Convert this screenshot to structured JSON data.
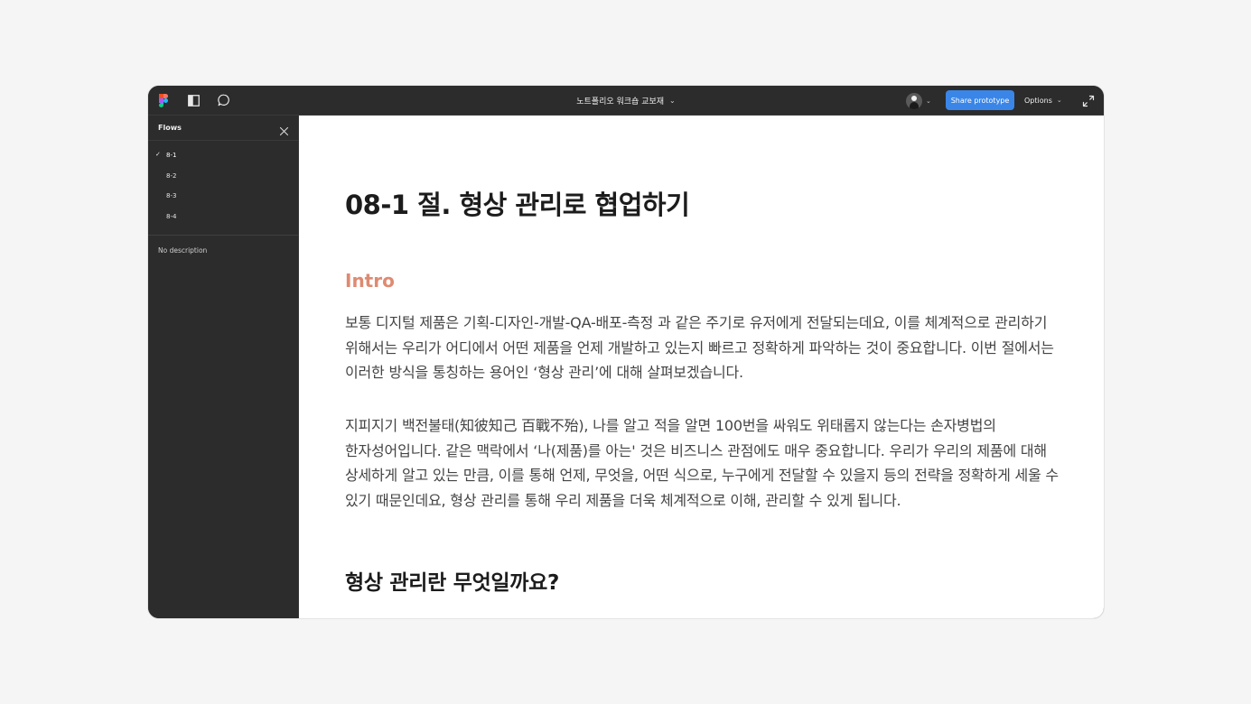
{
  "topbar": {
    "file_title": "노트폴리오 워크숍 교보재",
    "title_chevron": "⌄",
    "avatar_chevron": "⌄",
    "share_label": "Share prototype",
    "options_label": "Options",
    "options_chevron": "⌄"
  },
  "sidebar": {
    "title": "Flows",
    "items": [
      {
        "label": "8-1",
        "selected": true
      },
      {
        "label": "8-2",
        "selected": false
      },
      {
        "label": "8-3",
        "selected": false
      },
      {
        "label": "8-4",
        "selected": false
      }
    ],
    "description": "No description",
    "check_glyph": "✓"
  },
  "document": {
    "title": "08-1 절. 형상 관리로 협업하기",
    "intro_heading": "Intro",
    "paragraph1": "보통 디지털 제품은 기획-디자인-개발-QA-배포-측정 과 같은 주기로 유저에게 전달되는데요, 이를 체계적으로 관리하기 위해서는 우리가 어디에서 어떤 제품을 언제 개발하고 있는지 빠르고 정확하게 파악하는 것이 중요합니다. 이번 절에서는 이러한 방식을 통칭하는 용어인 ‘형상 관리’에 대해 살펴보겠습니다.",
    "paragraph2": "지피지기 백전불태(知彼知己 百戰不殆), 나를 알고 적을 알면 100번을 싸워도 위태롭지 않는다는 손자병법의 한자성어입니다. 같은 맥락에서 ‘나(제품)를 아는' 것은 비즈니스 관점에도 매우 중요합니다. 우리가 우리의 제품에 대해 상세하게 알고 있는 만큼, 이를 통해 언제, 무엇을, 어떤 식으로, 누구에게 전달할 수 있을지 등의 전략을 정확하게 세울 수 있기 때문인데요, 형상 관리를 통해 우리 제품을 더욱 체계적으로 이해, 관리할 수 있게 됩니다.",
    "section_heading": "형상 관리란 무엇일까요?"
  },
  "colors": {
    "accent": "#3a86e8",
    "intro_heading": "#de8a72",
    "topbar_bg": "#2c2c2c",
    "canvas_bg": "#ffffff"
  },
  "icons": [
    "figma-logo-icon",
    "sidebar-toggle-icon",
    "comment-icon",
    "avatar",
    "close-icon",
    "check-icon",
    "expand-icon"
  ]
}
